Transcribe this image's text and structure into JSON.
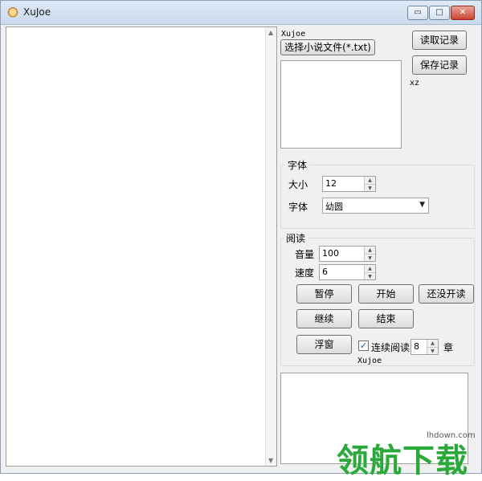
{
  "window": {
    "title": "XuJoe",
    "buttons": {
      "minimize": "▭",
      "maximize": "□",
      "close": "✕"
    }
  },
  "right": {
    "top_label": "Xujoe",
    "select_file_button": "选择小说文件(*.txt)",
    "read_record_button": "读取记录",
    "save_record_button": "保存记录",
    "xz_label": "xz"
  },
  "font_group": {
    "title": "字体",
    "size_label": "大小",
    "size_value": "12",
    "font_label": "字体",
    "font_value": "幼圆"
  },
  "read_group": {
    "title": "阅读",
    "volume_label": "音量",
    "volume_value": "100",
    "speed_label": "速度",
    "speed_value": "6",
    "pause_button": "暂停",
    "start_button": "开始",
    "unopened_button": "还没开读",
    "continue_button": "继续",
    "end_button": "结束",
    "float_button": "浮窗",
    "continuous_checkbox_label": "连续阅读",
    "continuous_checked": true,
    "chapter_count": "8",
    "chapter_unit": "章",
    "author_label": "Xujoe"
  },
  "watermark": {
    "site": "lhdown.com",
    "brand": "领航下载"
  },
  "colors": {
    "watermark_green": "#2aa83a",
    "close_red": "#c9452e"
  }
}
